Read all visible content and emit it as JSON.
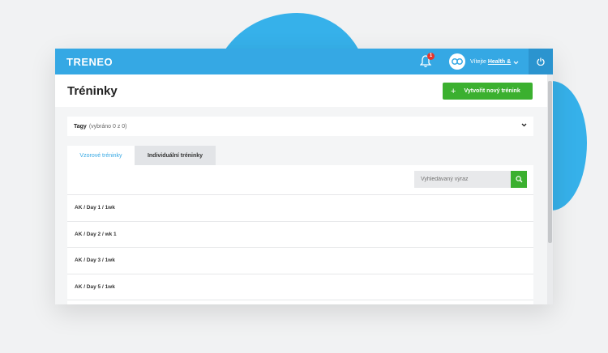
{
  "app": {
    "logo": "TRENEO"
  },
  "topbar": {
    "notification_count": "1",
    "greeting_prefix": "Vítejte",
    "user_name": "Health &"
  },
  "page": {
    "title": "Tréninky",
    "create_button_label": "Vytvořit nový trénink"
  },
  "tags": {
    "label": "Tagy",
    "selected_count": "(vybráno 0 z 0)"
  },
  "tabs": [
    {
      "label": "Vzorové tréninky",
      "active": true
    },
    {
      "label": "Individuální tréninky",
      "active": false
    }
  ],
  "search": {
    "placeholder": "Vyhledávaný výraz"
  },
  "trainings": [
    {
      "name": "AK / Day 1 / 1wk"
    },
    {
      "name": "AK / Day 2 / wk 1"
    },
    {
      "name": "AK / Day 3 / 1wk"
    },
    {
      "name": "AK / Day 5 / 1wk"
    }
  ],
  "colors": {
    "brand_blue": "#35a8e4",
    "accent_green": "#3bb02f",
    "alert_red": "#e8352b"
  }
}
